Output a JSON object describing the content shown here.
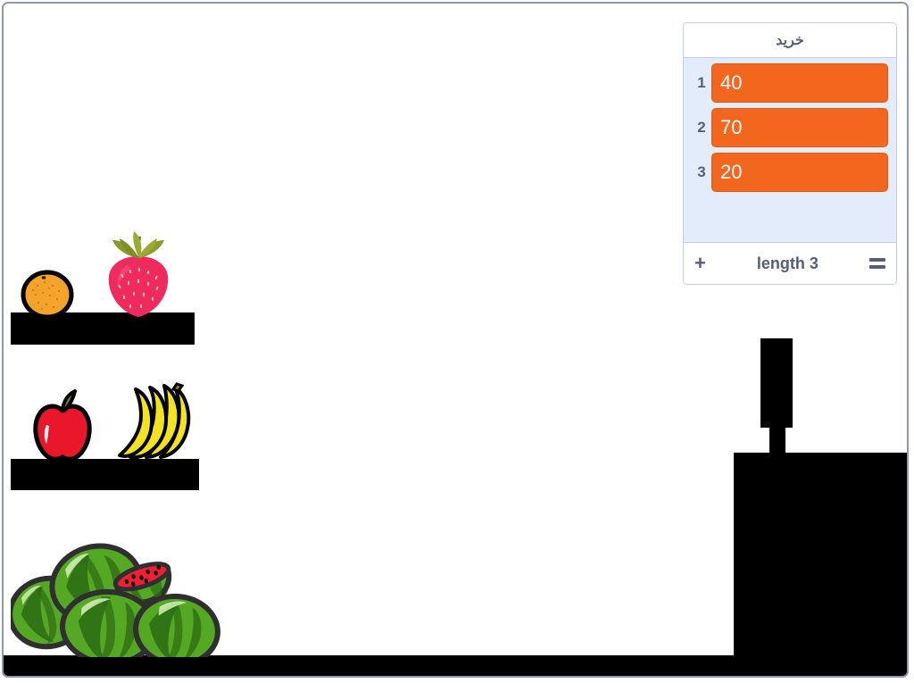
{
  "stage": {
    "background_color": "#ffffff",
    "border_color": "#8f99ad",
    "terrain_color": "#000000"
  },
  "list_monitor": {
    "title": "خرید",
    "rows": [
      {
        "index": "1",
        "value": "40"
      },
      {
        "index": "2",
        "value": "70"
      },
      {
        "index": "3",
        "value": "20"
      }
    ],
    "add_label": "+",
    "length_label": "length 3",
    "resize_label": "=",
    "colors": {
      "body_background": "#e3ecfb",
      "header_background": "#ffffff",
      "cell_background": "#f2661e",
      "cell_text": "#ffffff",
      "label_text": "#575e75",
      "border": "#c5cfe0"
    }
  },
  "sprites": [
    {
      "name": "orange",
      "label": "orange"
    },
    {
      "name": "strawberry",
      "label": "strawberry"
    },
    {
      "name": "apple",
      "label": "apple"
    },
    {
      "name": "bananas",
      "label": "bananas"
    },
    {
      "name": "watermelons",
      "label": "watermelons"
    }
  ],
  "terrain": [
    {
      "name": "platform-top"
    },
    {
      "name": "platform-middle"
    },
    {
      "name": "ground"
    },
    {
      "name": "tower-base"
    },
    {
      "name": "tower-pole"
    },
    {
      "name": "tower-head"
    }
  ]
}
